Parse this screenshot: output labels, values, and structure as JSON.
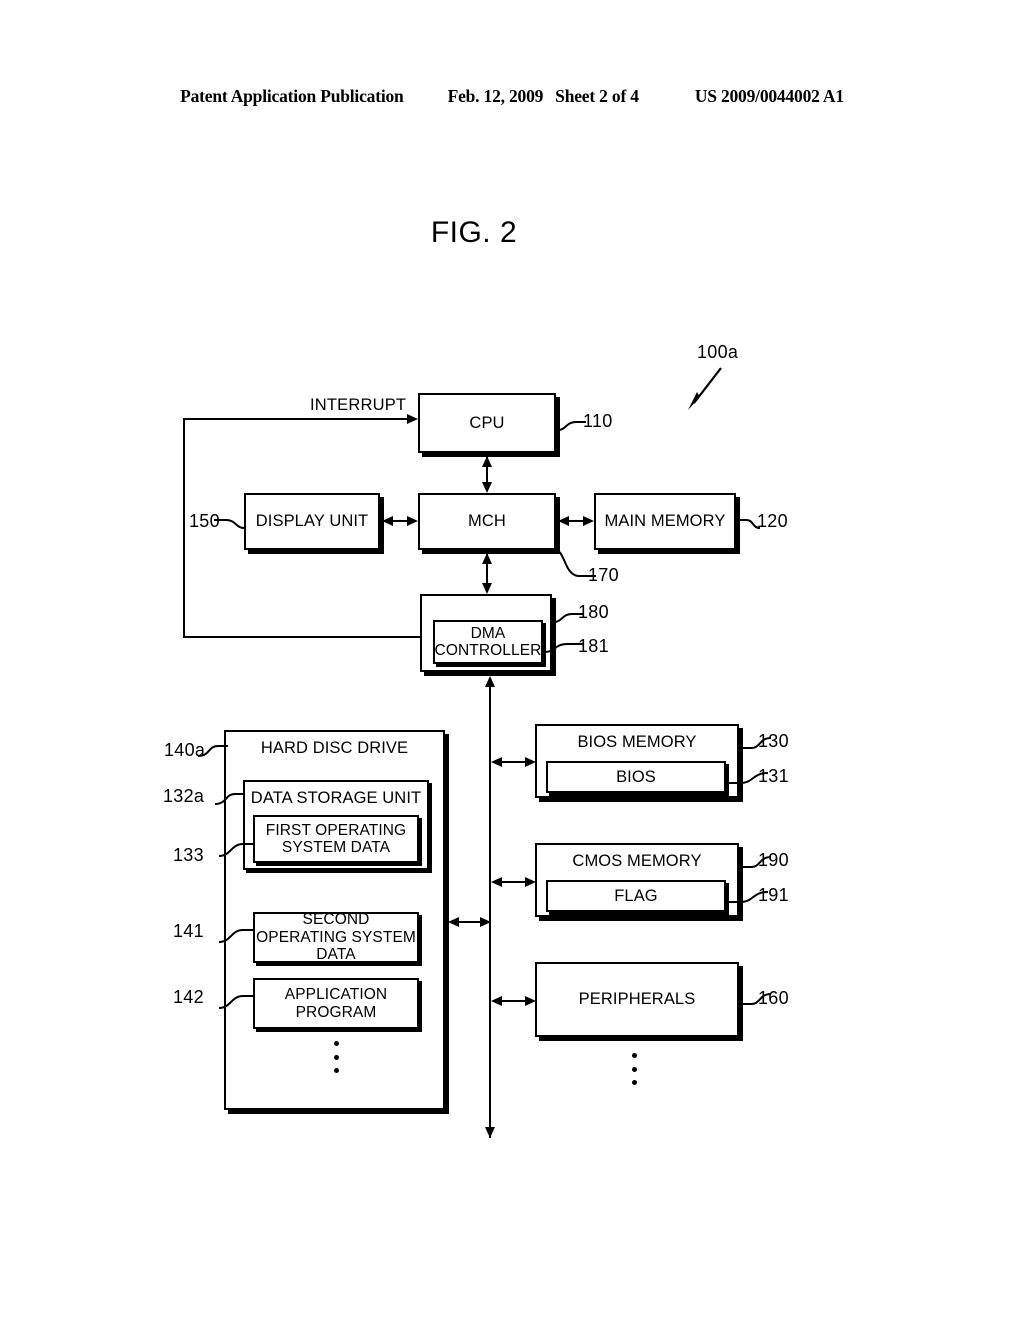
{
  "header": {
    "publication": "Patent Application Publication",
    "date": "Feb. 12, 2009",
    "sheet": "Sheet 2 of 4",
    "docnum": "US 2009/0044002 A1"
  },
  "figure": {
    "title": "FIG. 2",
    "system_ref": "100a"
  },
  "edge_labels": {
    "interrupt": "INTERRUPT"
  },
  "blocks": {
    "cpu": {
      "label": "CPU",
      "ref": "110"
    },
    "display_unit": {
      "label": "DISPLAY UNIT",
      "ref": "150"
    },
    "mch": {
      "label": "MCH",
      "ref": "170"
    },
    "main_memory": {
      "label": "MAIN MEMORY",
      "ref": "120"
    },
    "ich": {
      "label": "",
      "ref": "180"
    },
    "dma_controller": {
      "label": "DMA CONTROLLER",
      "ref": "181"
    },
    "hard_disc_drive": {
      "label": "HARD DISC DRIVE",
      "ref": "140a"
    },
    "data_storage": {
      "label": "DATA STORAGE UNIT",
      "ref": "132a"
    },
    "first_os_data": {
      "label": "FIRST OPERATING SYSTEM DATA",
      "ref": "133"
    },
    "second_os_data": {
      "label": "SECOND OPERATING SYSTEM DATA",
      "ref": "141"
    },
    "application": {
      "label": "APPLICATION PROGRAM",
      "ref": "142"
    },
    "bios_memory": {
      "label": "BIOS MEMORY",
      "ref": "130"
    },
    "bios": {
      "label": "BIOS",
      "ref": "131"
    },
    "cmos_memory": {
      "label": "CMOS MEMORY",
      "ref": "190"
    },
    "flag": {
      "label": "FLAG",
      "ref": "191"
    },
    "peripherals": {
      "label": "PERIPHERALS",
      "ref": "160"
    }
  }
}
